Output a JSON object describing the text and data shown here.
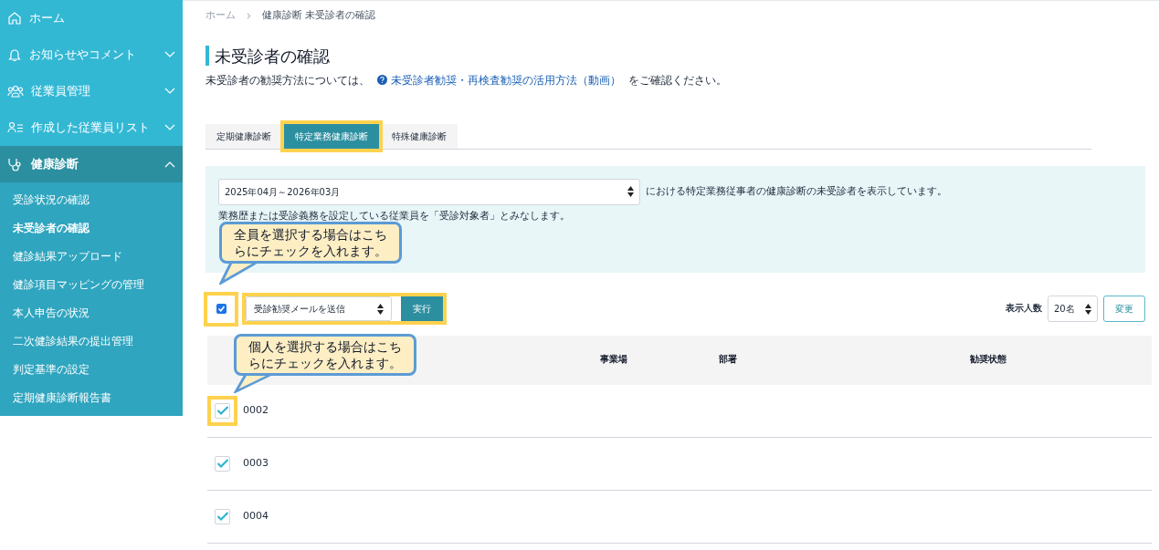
{
  "sidebar": {
    "items": [
      {
        "label": "ホーム"
      },
      {
        "label": "お知らせやコメント",
        "expanded": false
      },
      {
        "label": "従業員管理",
        "expanded": false
      },
      {
        "label": "作成した従業員リスト",
        "expanded": false
      },
      {
        "label": "健康診断",
        "expanded": true,
        "children": [
          {
            "label": "受診状況の確認",
            "selected": false
          },
          {
            "label": "未受診者の確認",
            "selected": true
          },
          {
            "label": "健診結果アップロード",
            "selected": false
          },
          {
            "label": "健診項目マッピングの管理",
            "selected": false
          },
          {
            "label": "本人申告の状況",
            "selected": false
          },
          {
            "label": "二次健診結果の提出管理",
            "selected": false
          },
          {
            "label": "判定基準の設定",
            "selected": false
          },
          {
            "label": "定期健康診断報告書",
            "selected": false
          }
        ]
      }
    ]
  },
  "breadcrumb": [
    "ホーム",
    "健康診断 未受診者の確認"
  ],
  "page_title": "未受診者の確認",
  "intro": {
    "before": "未受診者の勧奨方法については、",
    "link": "未受診者勧奨・再検査勧奨の活用方法（動画）",
    "after": "をご確認ください。"
  },
  "tabs": [
    {
      "label": "定期健康診断",
      "selected": false
    },
    {
      "label": "特定業務健康診断",
      "selected": true
    },
    {
      "label": "特殊健康診断",
      "selected": false
    }
  ],
  "filter": {
    "period": "2025年04月～2026年03月",
    "suffix": "における特定業務従事者の健康診断の未受診者を表示しています。",
    "note": "業務歴または受診義務を設定している従業員を「受診対象者」とみなします。"
  },
  "bulk": {
    "select_all_checked": true,
    "action": "受診勧奨メールを送信",
    "run_button": "実行"
  },
  "page_size": {
    "label": "表示人数",
    "value": "20名",
    "button": "変更"
  },
  "table": {
    "columns": [
      "事業場",
      "部署",
      "勧奨状態"
    ],
    "rows": [
      {
        "id": "0002",
        "checked": true
      },
      {
        "id": "0003",
        "checked": true
      },
      {
        "id": "0004",
        "checked": true
      }
    ]
  },
  "callouts": [
    {
      "text": "全員を選択する場合はこちらにチェックを入れます。"
    },
    {
      "text": "個人を選択する場合はこちらにチェックを入れます。"
    }
  ]
}
